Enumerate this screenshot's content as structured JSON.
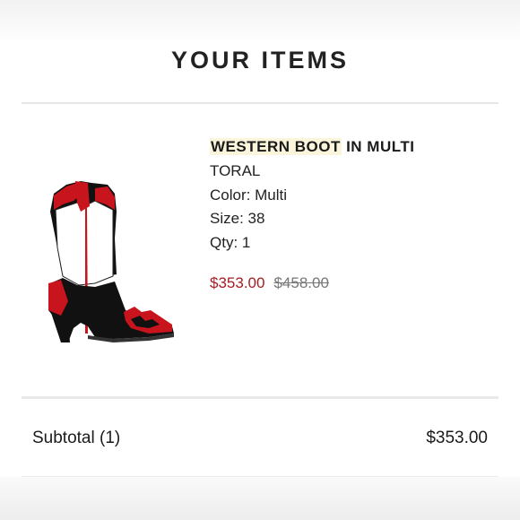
{
  "header": {
    "title": "YOUR ITEMS"
  },
  "item": {
    "name_highlight": "WESTERN BOOT",
    "name_rest": " IN MULTI",
    "brand": "TORAL",
    "color_label": "Color:",
    "color_value": "Multi",
    "size_label": "Size:",
    "size_value": "38",
    "qty_label": "Qty:",
    "qty_value": "1",
    "sale_price": "$353.00",
    "original_price": "$458.00",
    "image_icon": "western-boot-image"
  },
  "summary": {
    "subtotal_label": "Subtotal (1)",
    "subtotal_value": "$353.00"
  },
  "colors": {
    "sale_price": "#a41d22",
    "boot_red": "#c8141c",
    "boot_black": "#111111",
    "highlight": "#fbf5dc"
  }
}
